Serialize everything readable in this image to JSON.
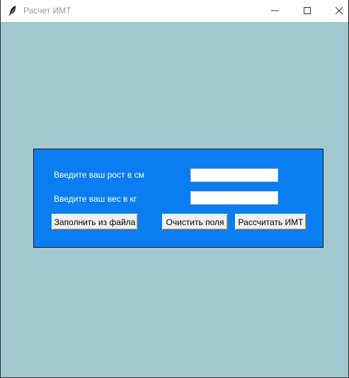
{
  "window": {
    "title": "Расчет ИМТ",
    "background_color": "#a0c8ce",
    "controls": {
      "minimize_icon": "minimize-icon",
      "maximize_icon": "maximize-icon",
      "close_icon": "close-icon"
    },
    "app_icon": "feather-icon"
  },
  "form": {
    "background_color": "#0a7ef0",
    "height_label": "Введите ваш рост в см",
    "height_value": "",
    "weight_label": "Введите ваш вес в кг",
    "weight_value": "",
    "buttons": {
      "fill_from_file": "Заполнить из файла",
      "clear_fields": "Очистить поля",
      "calculate": "Рассчитать ИМТ"
    }
  }
}
